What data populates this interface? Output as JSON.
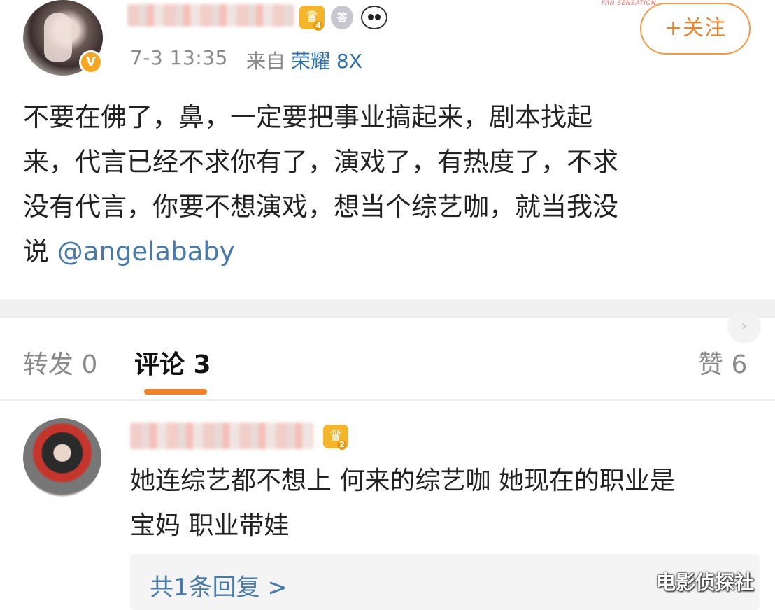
{
  "post": {
    "header": {
      "crown_level": "4",
      "medal_glyph": "答",
      "time": "7-3 13:35",
      "from_label": "来自",
      "device": "荣耀 8X",
      "follow_label": "+关注",
      "top_deco": "FAN SENSATION"
    },
    "verified_glyph": "V",
    "content_lines": [
      "不要在佛了，鼻，一定要把事业搞起来，剧本找起",
      "来，代言已经不求你有了，演戏了，有热度了，不求",
      "没有代言，你要不想演戏，想当个综艺咖，就当我没"
    ],
    "last_line_prefix": "说 ",
    "mention": "@angelababy"
  },
  "tabs": [
    {
      "label": "转发 0",
      "active": false
    },
    {
      "label": "评论 3",
      "active": true
    },
    {
      "label": "赞 6",
      "active": false
    }
  ],
  "scroll_icon_glyph": "›",
  "comment": {
    "crown_level": "2",
    "text_lines": [
      "她连综艺都不想上 何来的综艺咖 她现在的职业是",
      "宝妈 职业带娃"
    ],
    "reply_link": "共1条回复 >"
  },
  "watermark": "电影侦探社",
  "colors": {
    "accent_orange": "#f0822b",
    "link_blue": "#4a7ba8",
    "meta_gray": "#8b8b8b",
    "crown_gold": "#f3b52c"
  },
  "icons": {
    "crown": "crown-badge-icon",
    "medal": "medal-badge-icon",
    "panda": "panda-icon",
    "verified": "verified-v-icon"
  }
}
